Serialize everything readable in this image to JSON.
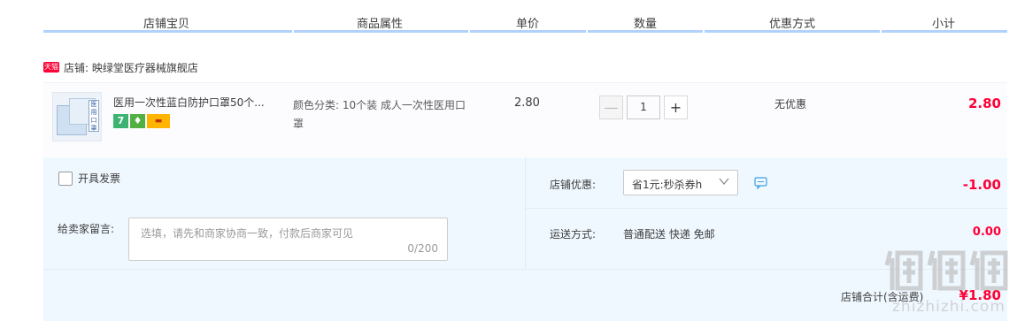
{
  "header": {
    "columns": [
      "店铺宝贝",
      "商品属性",
      "单价",
      "数量",
      "优惠方式",
      "小计"
    ]
  },
  "shop": {
    "badge": "天猫",
    "name": "店铺: 映绿堂医疗器械旗舰店"
  },
  "item": {
    "thumb_text": "医用口罩",
    "title": "医用一次性蓝白防护口罩50个...",
    "service_badges": [
      "7",
      "♦",
      "▬"
    ],
    "props": "颜色分类: 10个装 成人一次性医用口罩",
    "price": "2.80",
    "quantity": "1",
    "minus_label": "—",
    "plus_label": "+",
    "discount": "无优惠",
    "subtotal": "2.80"
  },
  "order": {
    "invoice_label": "开具发票",
    "message_label": "给卖家留言:",
    "message_placeholder": "选填，请先和商家协商一致，付款后商家可见",
    "message_count": "0/200",
    "shop_discount_label": "店铺优惠:",
    "coupon_selected": "省1元:秒杀券h",
    "discount_amount": "-1.00",
    "shipping_label": "运送方式:",
    "shipping_value": "普通配送 快递 免邮",
    "shipping_amount": "0.00",
    "total_label": "店铺合计(含运费)",
    "total_amount": "¥1.80"
  },
  "watermark": {
    "text": "zhizhizhi.com"
  },
  "colors": {
    "accent_red": "#ff0036",
    "header_line": "#b2d1ff",
    "panel_bg": "#f0f8ff"
  }
}
